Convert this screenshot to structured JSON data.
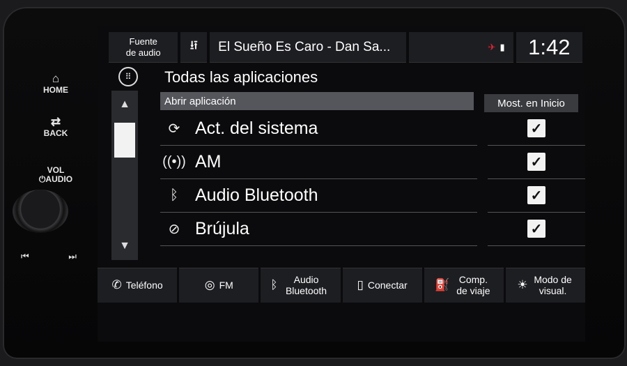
{
  "hardware": {
    "home": "HOME",
    "back": "BACK",
    "vol_line1": "VOL",
    "vol_line2": "AUDIO"
  },
  "topbar": {
    "source_line1": "Fuente",
    "source_line2": "de audio",
    "now_playing": "El Sueño Es Caro - Dan Sa...",
    "clock": "1:42"
  },
  "page": {
    "title": "Todas las aplicaciones",
    "col_open": "Abrir aplicación",
    "col_show": "Most. en Inicio"
  },
  "apps": [
    {
      "label": "Act. del sistema",
      "icon": "refresh-icon",
      "checked": true
    },
    {
      "label": "AM",
      "icon": "radio-antenna-icon",
      "checked": true
    },
    {
      "label": "Audio Bluetooth",
      "icon": "bluetooth-icon",
      "checked": true
    },
    {
      "label": "Brújula",
      "icon": "compass-icon",
      "checked": true
    }
  ],
  "bottom_nav": [
    {
      "label": "Teléfono",
      "icon": "phone-icon"
    },
    {
      "label": "FM",
      "icon": "radio-icon"
    },
    {
      "label": "Audio Bluetooth",
      "icon": "bluetooth-icon"
    },
    {
      "label": "Conectar",
      "icon": "smartphone-icon"
    },
    {
      "label": "Comp. de viaje",
      "icon": "fuel-icon"
    },
    {
      "label": "Modo de visual.",
      "icon": "brightness-icon"
    }
  ]
}
